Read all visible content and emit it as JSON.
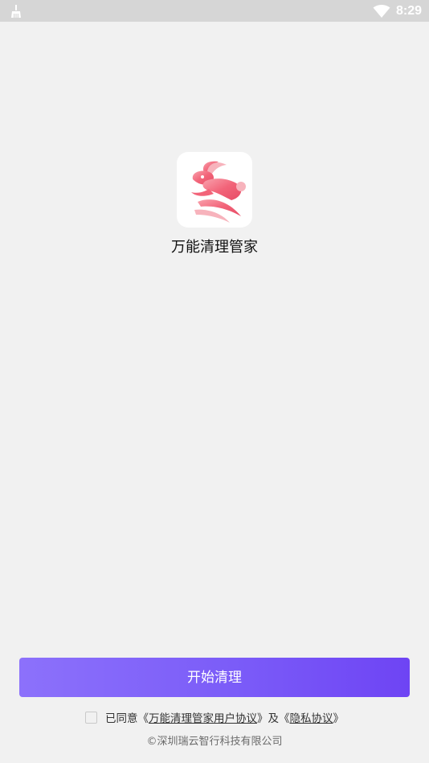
{
  "status_bar": {
    "left_icon": "cleaner-broom-icon",
    "wifi_icon": "wifi-icon",
    "time": "8:29"
  },
  "app": {
    "logo_icon": "rabbit-logo-icon",
    "name": "万能清理管家"
  },
  "actions": {
    "start_button_label": "开始清理"
  },
  "agreement": {
    "prefix": "已同意《",
    "user_agreement_link": "万能清理管家用户协议",
    "middle": "》及《",
    "privacy_link": "隐私协议",
    "suffix": "》",
    "checked": false
  },
  "footer": {
    "copyright": "©深圳瑞云智行科技有限公司"
  },
  "colors": {
    "background": "#f1f1f1",
    "status_bar": "#d6d6d6",
    "button_gradient_start": "#8c71fb",
    "button_gradient_end": "#6e44f4",
    "logo_accent": "#f06478"
  }
}
